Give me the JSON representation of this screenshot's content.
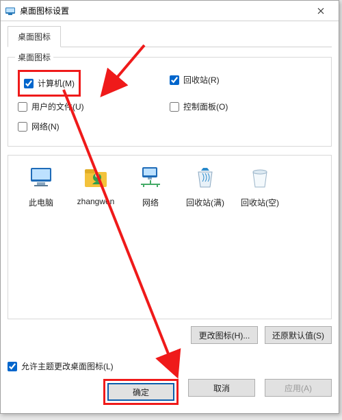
{
  "window": {
    "title": "桌面图标设置"
  },
  "tab": {
    "label": "桌面图标"
  },
  "group": {
    "legend": "桌面图标",
    "computer": "计算机(M)",
    "recycle": "回收站(R)",
    "userfiles": "用户的文件(U)",
    "controlpanel": "控制面板(O)",
    "network": "网络(N)"
  },
  "checked": {
    "computer": true,
    "recycle": true,
    "userfiles": false,
    "controlpanel": false,
    "network": false,
    "allow": true
  },
  "icons": {
    "thispc": "此电脑",
    "user": "zhangwen",
    "network": "网络",
    "recycle_full": "回收站(满)",
    "recycle_empty": "回收站(空)"
  },
  "buttons": {
    "change": "更改图标(H)...",
    "restore": "还原默认值(S)",
    "allow": "允许主题更改桌面图标(L)",
    "ok": "确定",
    "cancel": "取消",
    "apply": "应用(A)"
  }
}
